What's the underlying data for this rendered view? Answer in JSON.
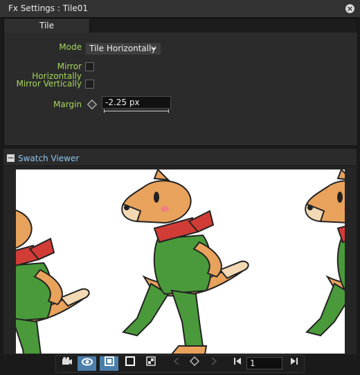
{
  "window": {
    "title": "Fx Settings : Tile01"
  },
  "tabs": [
    {
      "label": "Tile"
    }
  ],
  "fields": {
    "mode": {
      "label": "Mode",
      "value": "Tile Horizontally"
    },
    "mirror_h": {
      "label": "Mirror Horizontally",
      "checked": false
    },
    "mirror_v": {
      "label": "Mirror Vertically",
      "checked": false
    },
    "margin": {
      "label": "Margin",
      "value": "-2.25 px"
    }
  },
  "swatch": {
    "label": "Swatch Viewer"
  },
  "toolbar": {
    "icons": [
      "camera-icon",
      "eye-icon",
      "preview-icon",
      "checkerboard-icon",
      "bg-toggle-icon",
      "prev-key-icon",
      "keyframe-icon",
      "next-key-icon",
      "first-frame-icon",
      "last-frame-icon"
    ],
    "frame_value": "1"
  },
  "colors": {
    "accent_label": "#a6d65c",
    "link": "#8ec6f0",
    "active_button": "#4a7fab"
  }
}
